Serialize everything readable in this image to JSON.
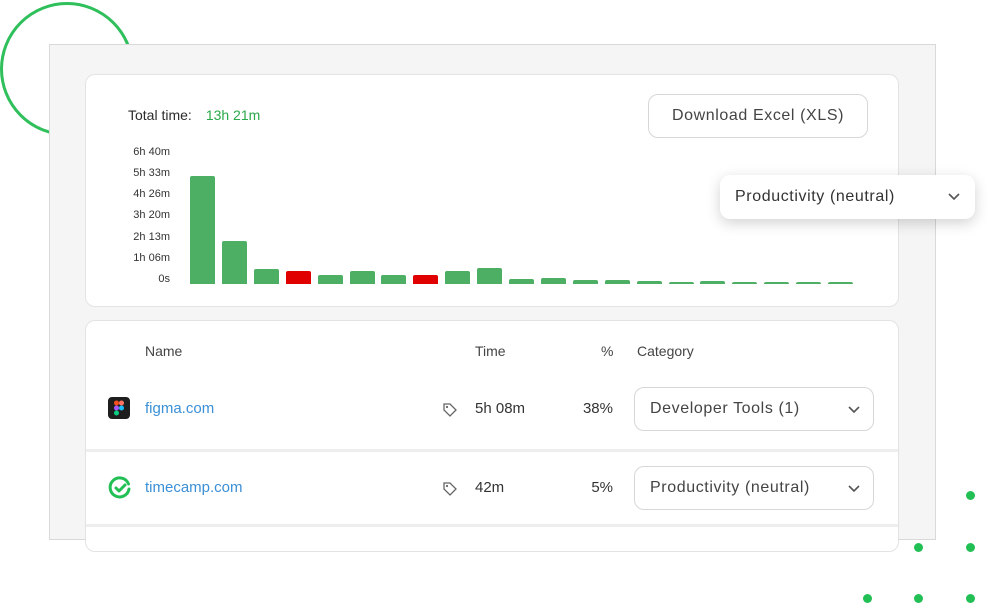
{
  "summary": {
    "total_label": "Total time:",
    "total_value": "13h 21m"
  },
  "toolbar": {
    "download_label": "Download Excel (XLS)"
  },
  "filter": {
    "selected": "Productivity (neutral)"
  },
  "chart_data": {
    "type": "bar",
    "y_ticks": [
      "6h 40m",
      "5h 33m",
      "4h 26m",
      "3h 20m",
      "2h 13m",
      "1h 06m",
      "0s"
    ],
    "ylim_minutes": [
      0,
      400
    ],
    "values_minutes": [
      327,
      130,
      45,
      40,
      28,
      38,
      28,
      28,
      38,
      48,
      14,
      17,
      12,
      12,
      9,
      6,
      8,
      5,
      4,
      4,
      3
    ],
    "bar_status": [
      "productive",
      "productive",
      "productive",
      "distracting",
      "productive",
      "productive",
      "productive",
      "distracting",
      "productive",
      "productive",
      "productive",
      "productive",
      "productive",
      "productive",
      "productive",
      "productive",
      "productive",
      "productive",
      "productive",
      "productive",
      "productive"
    ],
    "colors": {
      "productive": "#4caf63",
      "distracting": "#e00000"
    }
  },
  "table": {
    "headers": {
      "name": "Name",
      "time": "Time",
      "percent": "%",
      "category": "Category"
    },
    "rows": [
      {
        "name": "figma.com",
        "icon": "figma-icon",
        "time": "5h 08m",
        "percent": "38%",
        "category": "Developer Tools (1)"
      },
      {
        "name": "timecamp.com",
        "icon": "timecamp-icon",
        "time": "42m",
        "percent": "5%",
        "category": "Productivity (neutral)"
      }
    ]
  },
  "colors": {
    "accent_green": "#2aa84a",
    "link_blue": "#3b8fd6",
    "decor_green": "#22bf55"
  }
}
